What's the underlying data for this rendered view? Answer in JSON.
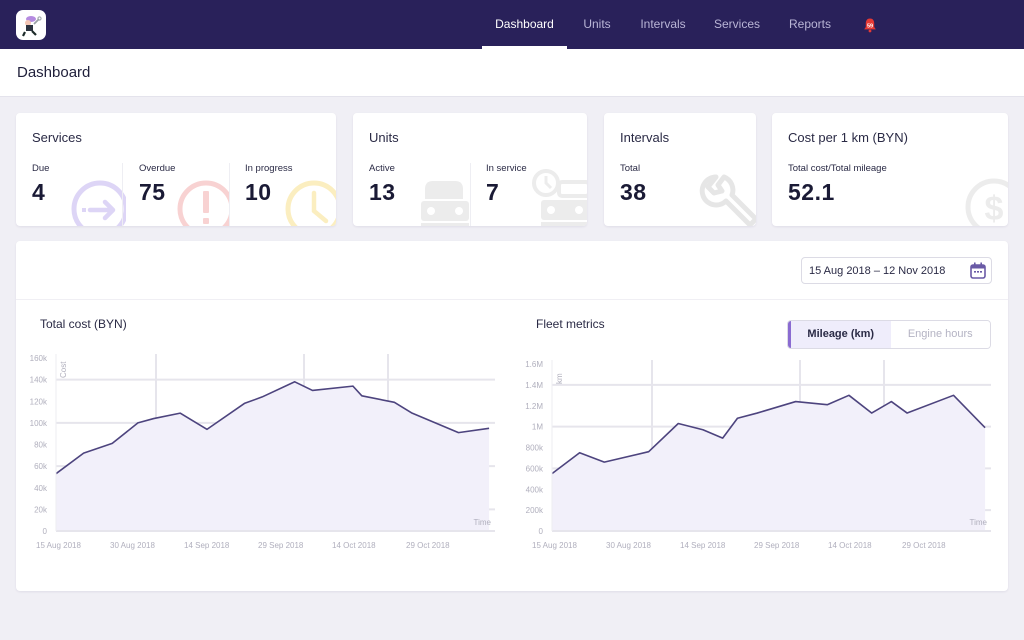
{
  "topbar": {
    "nav": [
      {
        "label": "Dashboard",
        "active": true
      },
      {
        "label": "Units",
        "active": false
      },
      {
        "label": "Intervals",
        "active": false
      },
      {
        "label": "Services",
        "active": false
      },
      {
        "label": "Reports",
        "active": false
      }
    ],
    "notifications_count": "59"
  },
  "page": {
    "title": "Dashboard"
  },
  "cards": {
    "services": {
      "title": "Services",
      "metrics": [
        {
          "label": "Due",
          "value": "4",
          "icon": "arrow-circle-icon",
          "color": "#c9bff0"
        },
        {
          "label": "Overdue",
          "value": "75",
          "icon": "alert-circle-icon",
          "color": "#f5c1c1"
        },
        {
          "label": "In progress",
          "value": "10",
          "icon": "clock-icon",
          "color": "#f8e6a8"
        }
      ]
    },
    "units": {
      "title": "Units",
      "metrics": [
        {
          "label": "Active",
          "value": "13",
          "icon": "car-icon"
        },
        {
          "label": "In service",
          "value": "7",
          "icon": "car-clock-icon"
        }
      ]
    },
    "intervals": {
      "title": "Intervals",
      "metrics": [
        {
          "label": "Total",
          "value": "38",
          "icon": "wrench-icon"
        }
      ]
    },
    "cost": {
      "title": "Cost per 1 km (BYN)",
      "metrics": [
        {
          "label": "Total cost/Total mileage",
          "value": "52.1",
          "icon": "dollar-coin-icon"
        }
      ]
    }
  },
  "filters": {
    "date_range": "15 Aug 2018 – 12 Nov 2018"
  },
  "fleet_toggle": [
    {
      "label": "Mileage (km)",
      "active": true
    },
    {
      "label": "Engine hours",
      "active": false
    }
  ],
  "colors": {
    "nav_bg": "#29215a",
    "line": "#4d447e",
    "area": "#f2f0fa",
    "accent": "#8a6bd1",
    "badge": "#e53935"
  },
  "chart_data": [
    {
      "type": "area",
      "title": "Total cost (BYN)",
      "xlabel": "Time",
      "ylabel": "Cost",
      "ylim": [
        0,
        160000
      ],
      "yticks": [
        0,
        20000,
        40000,
        60000,
        80000,
        100000,
        120000,
        140000,
        160000
      ],
      "ytick_labels": [
        "0",
        "20k",
        "40k",
        "60k",
        "80k",
        "100k",
        "120k",
        "140k",
        "160k"
      ],
      "xlim": [
        "2018-08-15",
        "2018-11-12"
      ],
      "xtick_labels": [
        "15 Aug 2018",
        "30 Aug 2018",
        "14 Sep 2018",
        "29 Sep 2018",
        "14 Oct 2018",
        "29 Oct 2018"
      ],
      "grid": true,
      "x": [
        0,
        5.6,
        11.4,
        16.6,
        19.8,
        25.2,
        30.6,
        38.2,
        41.8,
        48.4,
        52.0,
        60.2,
        62.0,
        68.6,
        72.2,
        81.6,
        87.8
      ],
      "values": [
        53000,
        72000,
        81000,
        100000,
        104000,
        109000,
        94000,
        118000,
        124000,
        138000,
        130000,
        134000,
        125000,
        119000,
        109000,
        91000,
        95000
      ]
    },
    {
      "type": "area",
      "title": "Fleet metrics",
      "xlabel": "Time",
      "ylabel": "km",
      "ylim": [
        0,
        1600000
      ],
      "yticks": [
        0,
        200000,
        400000,
        600000,
        800000,
        1000000,
        1200000,
        1400000,
        1600000
      ],
      "ytick_labels": [
        "0",
        "200k",
        "400k",
        "600k",
        "800k",
        "1M",
        "1.2M",
        "1.4M",
        "1.6M"
      ],
      "xlim": [
        "2018-08-15",
        "2018-11-12"
      ],
      "xtick_labels": [
        "15 Aug 2018",
        "30 Aug 2018",
        "14 Sep 2018",
        "29 Sep 2018",
        "14 Oct 2018",
        "29 Oct 2018"
      ],
      "grid": true,
      "series_name": "Mileage (km)",
      "x": [
        0,
        5.6,
        10.6,
        19.6,
        25.6,
        30.6,
        34.6,
        37.6,
        41.6,
        49.4,
        55.8,
        60.2,
        64.8,
        68.8,
        72.0,
        81.4,
        87.8
      ],
      "values": [
        550000,
        750000,
        660000,
        760000,
        1030000,
        970000,
        890000,
        1080000,
        1130000,
        1240000,
        1210000,
        1300000,
        1130000,
        1240000,
        1130000,
        1300000,
        990000
      ]
    }
  ]
}
